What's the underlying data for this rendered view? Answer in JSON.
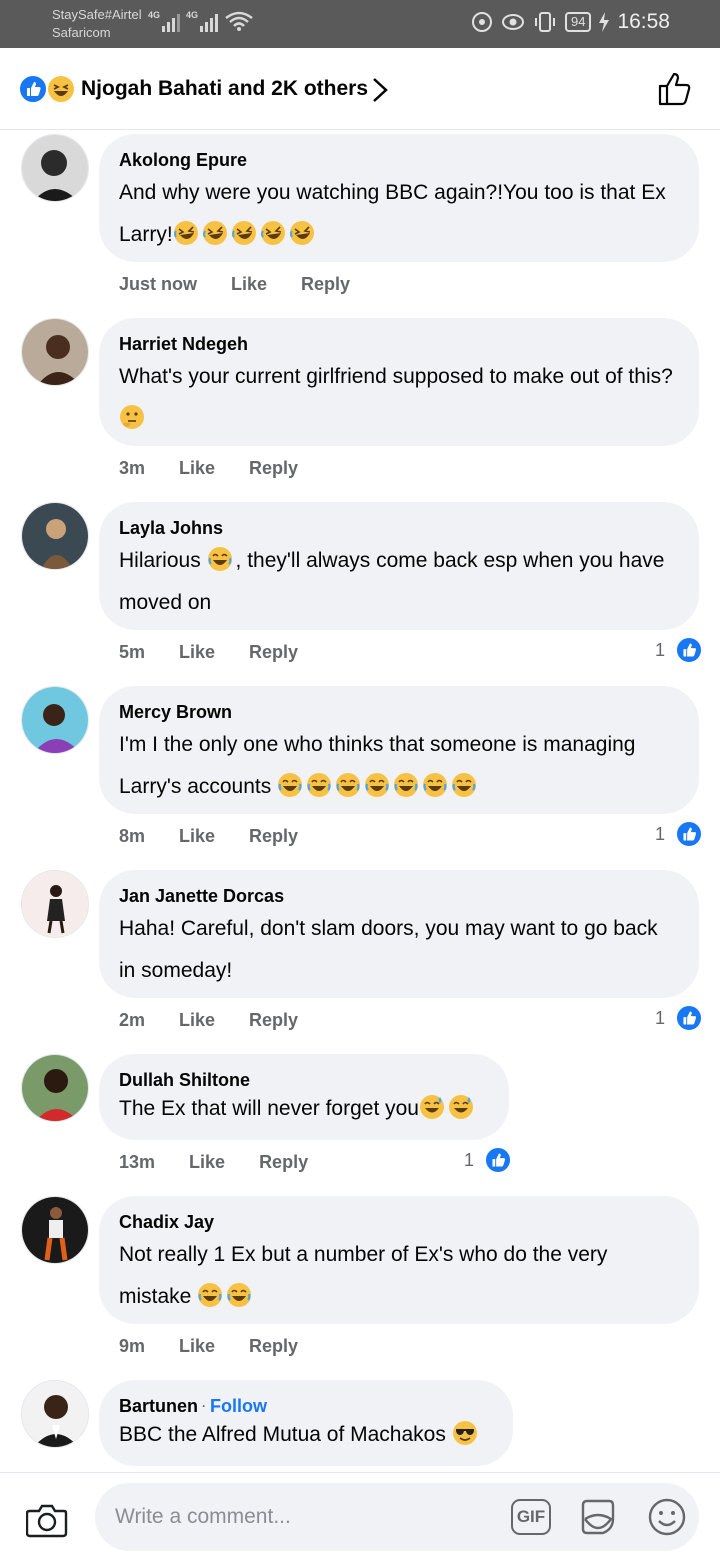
{
  "status_bar": {
    "carrier_line1": "StaySafe#Airtel",
    "carrier_line2": "Safaricom",
    "network1": "4G",
    "network2": "4G",
    "battery": "94",
    "time": "16:58"
  },
  "header": {
    "title": "Njogah Bahati and 2K others"
  },
  "comments": [
    {
      "author": "Akolong Epure",
      "text": "And why were you watching BBC again?!You too is that Ex Larry!",
      "emoji": [
        "rofl",
        "rofl",
        "rofl",
        "rofl",
        "rofl"
      ],
      "time": "Just now",
      "like": "Like",
      "reply": "Reply",
      "reactions": ""
    },
    {
      "author": "Harriet Ndegeh",
      "text": "What's your current girlfriend supposed to make out of this? ",
      "emoji": [
        "thinking"
      ],
      "time": "3m",
      "like": "Like",
      "reply": "Reply",
      "reactions": ""
    },
    {
      "author": "Layla Johns",
      "text_before": "Hilarious ",
      "text_after": ", they'll always come back esp when you have moved on",
      "emoji": [
        "joy"
      ],
      "time": "5m",
      "like": "Like",
      "reply": "Reply",
      "reactions": "1"
    },
    {
      "author": "Mercy Brown",
      "text": "I'm I the only one who thinks that someone is managing Larry's accounts ",
      "emoji": [
        "joy",
        "joy",
        "joy",
        "joy",
        "joy",
        "joy",
        "joy"
      ],
      "time": "8m",
      "like": "Like",
      "reply": "Reply",
      "reactions": "1"
    },
    {
      "author": "Jan Janette Dorcas",
      "text": "Haha! Careful, don't slam doors, you may want to go back in someday!",
      "time": "2m",
      "like": "Like",
      "reply": "Reply",
      "reactions": "1"
    },
    {
      "author": "Dullah Shiltone",
      "text": "The Ex that will never forget you",
      "emoji": [
        "sweat-smile",
        "sweat-smile"
      ],
      "time": "13m",
      "like": "Like",
      "reply": "Reply",
      "reactions": "1"
    },
    {
      "author": "Chadix Jay",
      "text": "Not really 1 Ex but a number of Ex's who do the very mistake ",
      "emoji": [
        "joy",
        "joy"
      ],
      "time": "9m",
      "like": "Like",
      "reply": "Reply",
      "reactions": ""
    },
    {
      "author": "Bartunen",
      "follow": "Follow",
      "text": "BBC the Alfred Mutua of Machakos ",
      "emoji": [
        "sunglasses"
      ],
      "time": "",
      "like": "",
      "reply": "",
      "reactions": ""
    }
  ],
  "composer": {
    "placeholder": "Write a comment...",
    "gif_label": "GIF"
  },
  "colors": {
    "accent": "#1877f2",
    "bubble": "#f0f2f5",
    "meta_text": "#65676b",
    "status_bar": "#5a5a5a"
  },
  "icons": [
    "like-reaction-icon",
    "haha-reaction-icon",
    "chevron-right-icon",
    "thumbs-up-icon",
    "camera-icon",
    "gif-icon",
    "sticker-icon",
    "emoji-icon"
  ]
}
